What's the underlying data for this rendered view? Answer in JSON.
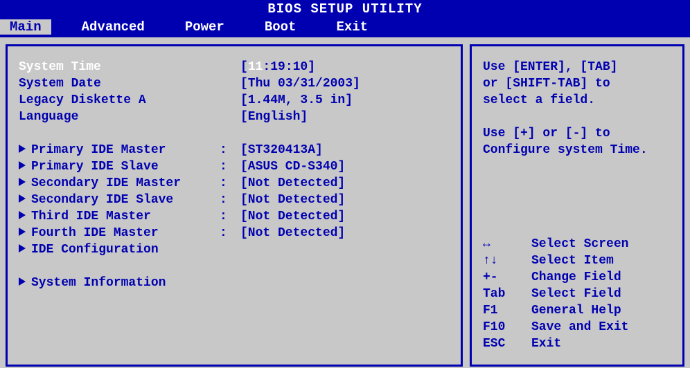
{
  "title": "BIOS SETUP UTILITY",
  "menu": [
    "Main",
    "Advanced",
    "Power",
    "Boot",
    "Exit"
  ],
  "selected_menu": "Main",
  "fields": {
    "system_time": {
      "label": "System Time",
      "value": "[11:19:10]",
      "hh": "11",
      "mm": ":19",
      "ss": ":10]"
    },
    "system_date": {
      "label": "System Date",
      "value": "[Thu 03/31/2003]"
    },
    "legacy_diskette": {
      "label": "Legacy Diskette A",
      "value": "[1.44M, 3.5 in]"
    },
    "language": {
      "label": "Language",
      "value": "[English]"
    }
  },
  "ide": [
    {
      "label": "Primary IDE Master",
      "value": "[ST320413A]"
    },
    {
      "label": "Primary IDE Slave",
      "value": "[ASUS CD-S340]"
    },
    {
      "label": "Secondary IDE Master",
      "value": "[Not Detected]"
    },
    {
      "label": "Secondary IDE Slave",
      "value": "[Not Detected]"
    },
    {
      "label": "Third IDE Master",
      "value": "[Not Detected]"
    },
    {
      "label": "Fourth IDE Master",
      "value": "[Not Detected]"
    },
    {
      "label": "IDE Configuration",
      "value": ""
    }
  ],
  "sysinfo": {
    "label": "System Information"
  },
  "help": {
    "line1": "Use [ENTER], [TAB]",
    "line2": "or [SHIFT-TAB] to",
    "line3": "select a field.",
    "line4": "Use [+] or [-] to",
    "line5": "Configure system Time."
  },
  "nav": [
    {
      "key": "↔",
      "desc": "Select Screen"
    },
    {
      "key": "↑↓",
      "desc": "Select Item"
    },
    {
      "key": "+-",
      "desc": "Change Field"
    },
    {
      "key": "Tab",
      "desc": "Select Field"
    },
    {
      "key": "F1",
      "desc": "General Help"
    },
    {
      "key": "F10",
      "desc": "Save and Exit"
    },
    {
      "key": "ESC",
      "desc": "Exit"
    }
  ]
}
